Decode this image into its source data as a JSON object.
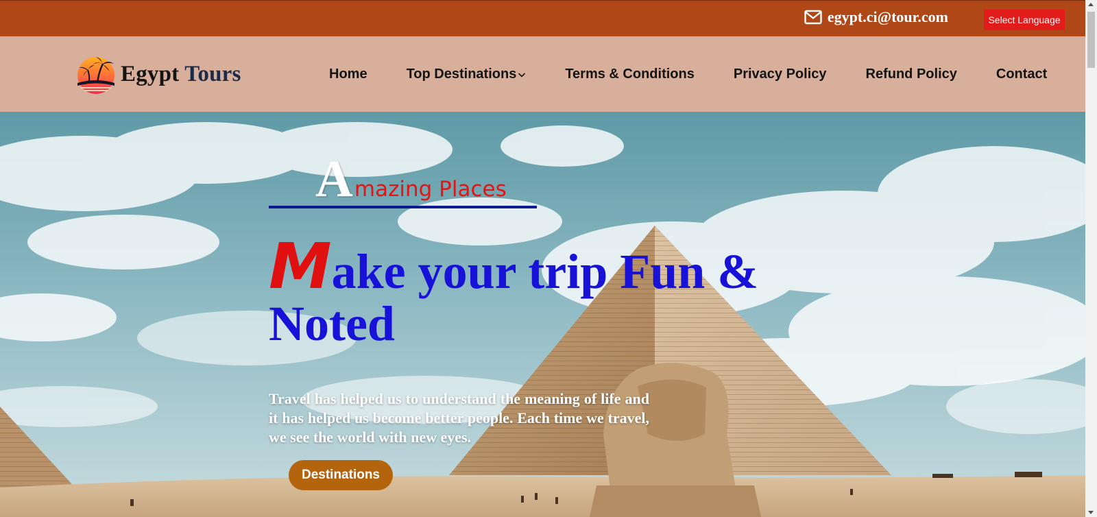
{
  "topbar": {
    "email": "egypt.ci@tour.com",
    "email_icon": "envelope-icon",
    "language_button": "Select Language"
  },
  "brand": {
    "name_part1": "Egypt",
    "name_part2": " Tours",
    "logo_icon": "palm-sunset-icon"
  },
  "nav": {
    "items": [
      {
        "label": "Home"
      },
      {
        "label": "Top Destinations",
        "has_dropdown": true
      },
      {
        "label": "Terms & Conditions"
      },
      {
        "label": "Privacy Policy"
      },
      {
        "label": "Refund Policy"
      },
      {
        "label": "Contact"
      }
    ]
  },
  "hero": {
    "eyebrow_cap": "A",
    "eyebrow_rest": "mazing Places",
    "headline_cap": "M",
    "headline_rest": "ake your trip Fun & Noted",
    "description": "Travel has helped us to understand the meaning of life and it has helped us become better people. Each time we travel, we see the world with new eyes.",
    "cta": "Destinations"
  },
  "colors": {
    "topbar_bg": "#b04716",
    "navbar_bg": "#d7af9b",
    "language_button_bg": "#e21b1b",
    "headline": "#1812d8",
    "accent_red": "#e01515",
    "underline": "#0b1c8f",
    "cta_bg": "#b5640e"
  }
}
